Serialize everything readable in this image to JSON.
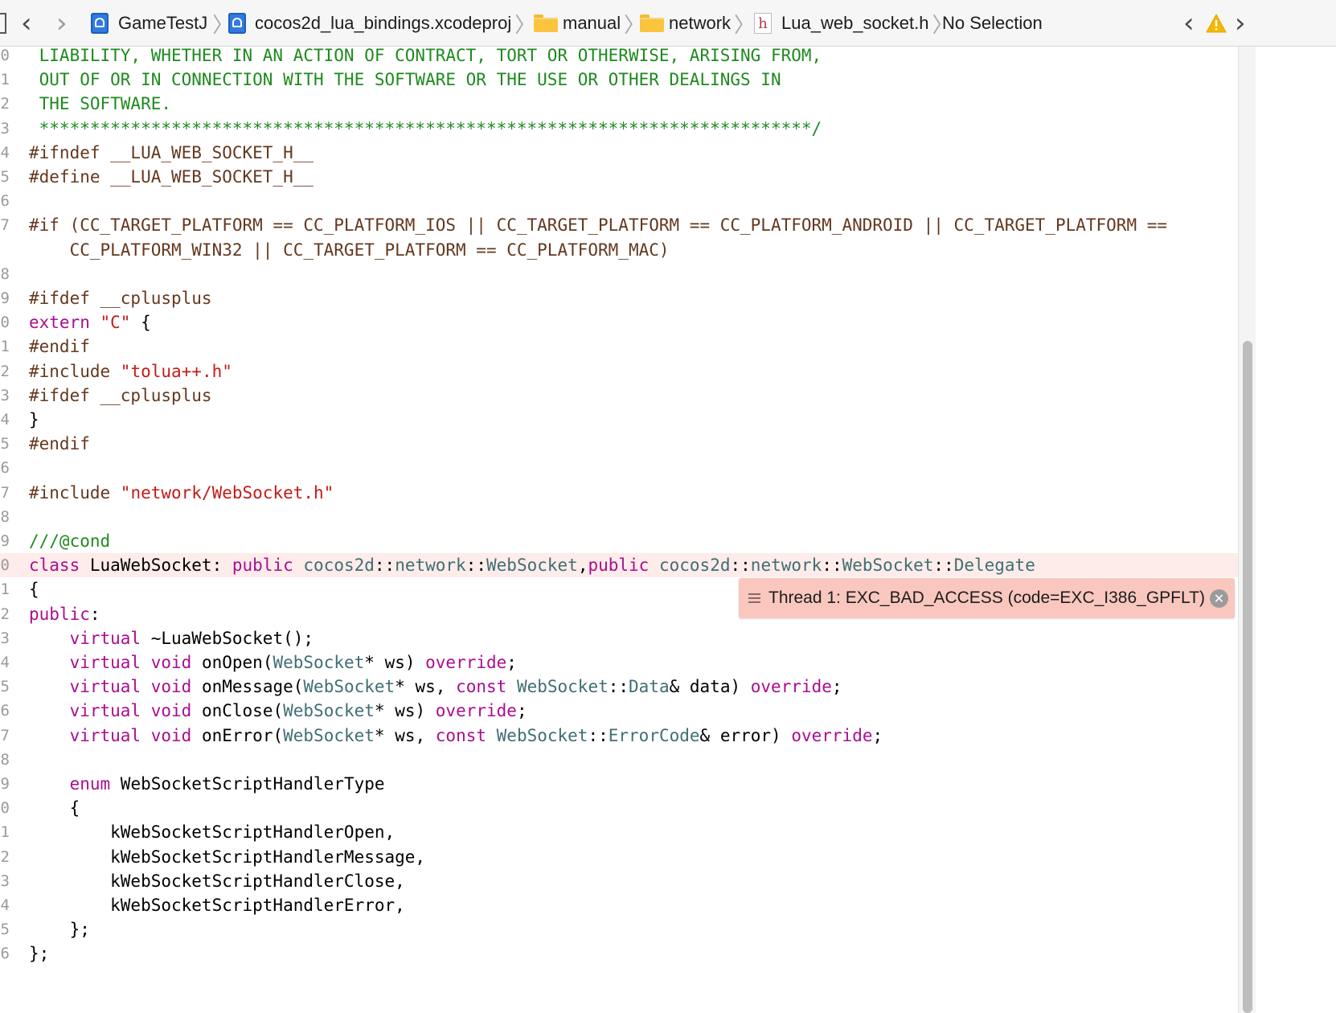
{
  "jumpbar": {
    "crumbs": [
      "GameTestJ",
      "cocos2d_lua_bindings.xcodeproj",
      "manual",
      "network",
      "Lua_web_socket.h",
      "No Selection"
    ]
  },
  "lines": [
    {
      "num": "0",
      "segs": [
        {
          "t": "c",
          "s": " LIABILITY, WHETHER IN AN ACTION OF CONTRACT, TORT OR OTHERWISE, ARISING FROM,"
        }
      ]
    },
    {
      "num": "1",
      "segs": [
        {
          "t": "c",
          "s": " OUT OF OR IN CONNECTION WITH THE SOFTWARE OR THE USE OR OTHER DEALINGS IN"
        }
      ]
    },
    {
      "num": "2",
      "segs": [
        {
          "t": "c",
          "s": " THE SOFTWARE."
        }
      ]
    },
    {
      "num": "3",
      "segs": [
        {
          "t": "c",
          "s": " ****************************************************************************/"
        }
      ]
    },
    {
      "num": "4",
      "segs": [
        {
          "t": "p",
          "s": "#ifndef __LUA_WEB_SOCKET_H__"
        }
      ]
    },
    {
      "num": "5",
      "segs": [
        {
          "t": "p",
          "s": "#define __LUA_WEB_SOCKET_H__"
        }
      ]
    },
    {
      "num": "6",
      "segs": []
    },
    {
      "num": "7",
      "segs": [
        {
          "t": "p",
          "s": "#if (CC_TARGET_PLATFORM == CC_PLATFORM_IOS || CC_TARGET_PLATFORM == CC_PLATFORM_ANDROID || CC_TARGET_PLATFORM =="
        }
      ]
    },
    {
      "num": "",
      "segs": [
        {
          "t": "p",
          "s": "    CC_PLATFORM_WIN32 || CC_TARGET_PLATFORM == CC_PLATFORM_MAC)"
        }
      ]
    },
    {
      "num": "8",
      "segs": []
    },
    {
      "num": "9",
      "segs": [
        {
          "t": "p",
          "s": "#ifdef __cplusplus"
        }
      ]
    },
    {
      "num": "0",
      "segs": [
        {
          "t": "k",
          "s": "extern"
        },
        {
          "t": "x",
          "s": " "
        },
        {
          "t": "s",
          "s": "\"C\""
        },
        {
          "t": "x",
          "s": " {"
        }
      ]
    },
    {
      "num": "1",
      "segs": [
        {
          "t": "p",
          "s": "#endif"
        }
      ]
    },
    {
      "num": "2",
      "segs": [
        {
          "t": "p",
          "s": "#include "
        },
        {
          "t": "s",
          "s": "\"tolua++.h\""
        }
      ]
    },
    {
      "num": "3",
      "segs": [
        {
          "t": "p",
          "s": "#ifdef __cplusplus"
        }
      ]
    },
    {
      "num": "4",
      "segs": [
        {
          "t": "x",
          "s": "}"
        }
      ]
    },
    {
      "num": "5",
      "segs": [
        {
          "t": "p",
          "s": "#endif"
        }
      ]
    },
    {
      "num": "6",
      "segs": []
    },
    {
      "num": "7",
      "segs": [
        {
          "t": "p",
          "s": "#include "
        },
        {
          "t": "s",
          "s": "\"network/WebSocket.h\""
        }
      ]
    },
    {
      "num": "8",
      "segs": []
    },
    {
      "num": "9",
      "segs": [
        {
          "t": "c",
          "s": "///@cond"
        }
      ]
    },
    {
      "num": "0",
      "err": true,
      "segs": [
        {
          "t": "k",
          "s": "class"
        },
        {
          "t": "x",
          "s": " LuaWebSocket: "
        },
        {
          "t": "k",
          "s": "public"
        },
        {
          "t": "x",
          "s": " "
        },
        {
          "t": "y",
          "s": "cocos2d"
        },
        {
          "t": "x",
          "s": "::"
        },
        {
          "t": "y",
          "s": "network"
        },
        {
          "t": "x",
          "s": "::"
        },
        {
          "t": "y",
          "s": "WebSocket"
        },
        {
          "t": "x",
          "s": ","
        },
        {
          "t": "k",
          "s": "public"
        },
        {
          "t": "x",
          "s": " "
        },
        {
          "t": "y",
          "s": "cocos2d"
        },
        {
          "t": "x",
          "s": "::"
        },
        {
          "t": "y",
          "s": "network"
        },
        {
          "t": "x",
          "s": "::"
        },
        {
          "t": "y",
          "s": "WebSocket"
        },
        {
          "t": "x",
          "s": "::"
        },
        {
          "t": "y",
          "s": "Delegate"
        }
      ]
    },
    {
      "num": "1",
      "segs": [
        {
          "t": "x",
          "s": "{"
        }
      ]
    },
    {
      "num": "2",
      "segs": [
        {
          "t": "k",
          "s": "public"
        },
        {
          "t": "x",
          "s": ":"
        }
      ]
    },
    {
      "num": "3",
      "segs": [
        {
          "t": "x",
          "s": "    "
        },
        {
          "t": "k",
          "s": "virtual"
        },
        {
          "t": "x",
          "s": " ~LuaWebSocket();"
        }
      ]
    },
    {
      "num": "4",
      "segs": [
        {
          "t": "x",
          "s": "    "
        },
        {
          "t": "k",
          "s": "virtual"
        },
        {
          "t": "x",
          "s": " "
        },
        {
          "t": "k",
          "s": "void"
        },
        {
          "t": "x",
          "s": " onOpen("
        },
        {
          "t": "y",
          "s": "WebSocket"
        },
        {
          "t": "x",
          "s": "* ws) "
        },
        {
          "t": "k",
          "s": "override"
        },
        {
          "t": "x",
          "s": ";"
        }
      ]
    },
    {
      "num": "5",
      "segs": [
        {
          "t": "x",
          "s": "    "
        },
        {
          "t": "k",
          "s": "virtual"
        },
        {
          "t": "x",
          "s": " "
        },
        {
          "t": "k",
          "s": "void"
        },
        {
          "t": "x",
          "s": " onMessage("
        },
        {
          "t": "y",
          "s": "WebSocket"
        },
        {
          "t": "x",
          "s": "* ws, "
        },
        {
          "t": "k",
          "s": "const"
        },
        {
          "t": "x",
          "s": " "
        },
        {
          "t": "y",
          "s": "WebSocket"
        },
        {
          "t": "x",
          "s": "::"
        },
        {
          "t": "y",
          "s": "Data"
        },
        {
          "t": "x",
          "s": "& data) "
        },
        {
          "t": "k",
          "s": "override"
        },
        {
          "t": "x",
          "s": ";"
        }
      ]
    },
    {
      "num": "6",
      "segs": [
        {
          "t": "x",
          "s": "    "
        },
        {
          "t": "k",
          "s": "virtual"
        },
        {
          "t": "x",
          "s": " "
        },
        {
          "t": "k",
          "s": "void"
        },
        {
          "t": "x",
          "s": " onClose("
        },
        {
          "t": "y",
          "s": "WebSocket"
        },
        {
          "t": "x",
          "s": "* ws) "
        },
        {
          "t": "k",
          "s": "override"
        },
        {
          "t": "x",
          "s": ";"
        }
      ]
    },
    {
      "num": "7",
      "segs": [
        {
          "t": "x",
          "s": "    "
        },
        {
          "t": "k",
          "s": "virtual"
        },
        {
          "t": "x",
          "s": " "
        },
        {
          "t": "k",
          "s": "void"
        },
        {
          "t": "x",
          "s": " onError("
        },
        {
          "t": "y",
          "s": "WebSocket"
        },
        {
          "t": "x",
          "s": "* ws, "
        },
        {
          "t": "k",
          "s": "const"
        },
        {
          "t": "x",
          "s": " "
        },
        {
          "t": "y",
          "s": "WebSocket"
        },
        {
          "t": "x",
          "s": "::"
        },
        {
          "t": "y",
          "s": "ErrorCode"
        },
        {
          "t": "x",
          "s": "& error) "
        },
        {
          "t": "k",
          "s": "override"
        },
        {
          "t": "x",
          "s": ";"
        }
      ]
    },
    {
      "num": "8",
      "segs": []
    },
    {
      "num": "9",
      "segs": [
        {
          "t": "x",
          "s": "    "
        },
        {
          "t": "k",
          "s": "enum"
        },
        {
          "t": "x",
          "s": " WebSocketScriptHandlerType"
        }
      ]
    },
    {
      "num": "0",
      "segs": [
        {
          "t": "x",
          "s": "    {"
        }
      ]
    },
    {
      "num": "1",
      "segs": [
        {
          "t": "x",
          "s": "        kWebSocketScriptHandlerOpen,"
        }
      ]
    },
    {
      "num": "2",
      "segs": [
        {
          "t": "x",
          "s": "        kWebSocketScriptHandlerMessage,"
        }
      ]
    },
    {
      "num": "3",
      "segs": [
        {
          "t": "x",
          "s": "        kWebSocketScriptHandlerClose,"
        }
      ]
    },
    {
      "num": "4",
      "segs": [
        {
          "t": "x",
          "s": "        kWebSocketScriptHandlerError,"
        }
      ]
    },
    {
      "num": "5",
      "segs": [
        {
          "t": "x",
          "s": "    };"
        }
      ]
    },
    {
      "num": "6",
      "segs": [
        {
          "t": "x",
          "s": "};"
        }
      ]
    }
  ],
  "error_banner": {
    "message": "Thread 1: EXC_BAD_ACCESS (code=EXC_I386_GPFLT)"
  },
  "colors": {
    "comment": "#1f8a1f",
    "preprocessor": "#643820",
    "string": "#c41a16",
    "keyword": "#aa0d91",
    "type": "#3f6e74",
    "error_line_bg": "#fdece9",
    "error_banner_bg": "#f9c7be",
    "warning": "#f5b800"
  },
  "icons": [
    "grid-icon",
    "back-arrow-icon",
    "forward-arrow-icon",
    "xcode-project-icon",
    "folder-icon",
    "header-file-icon",
    "warning-icon",
    "menu-icon",
    "close-icon"
  ]
}
